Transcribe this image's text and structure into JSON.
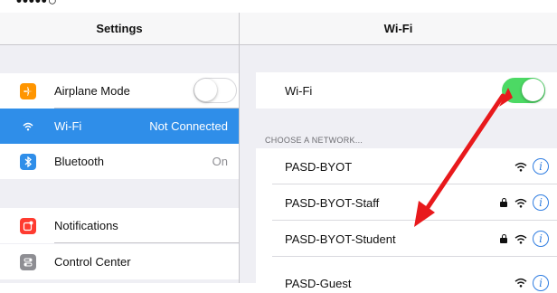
{
  "status_bar": {
    "text": "•••••○"
  },
  "settings": {
    "title": "Settings",
    "rows": [
      {
        "label": "Airplane Mode",
        "icon": "airplane-icon",
        "icon_color": "#ff9500",
        "toggle": "off"
      },
      {
        "label": "Wi-Fi",
        "value": "Not Connected",
        "icon": "wifi-icon",
        "icon_color": "#2f8ee9",
        "selected": true
      },
      {
        "label": "Bluetooth",
        "value": "On",
        "icon": "bluetooth-icon",
        "icon_color": "#2f8ee9"
      },
      {
        "label": "Notifications",
        "icon": "notifications-icon",
        "icon_color": "#ff3b30"
      },
      {
        "label": "Control Center",
        "icon": "control-center-icon",
        "icon_color": "#8e8e93"
      }
    ]
  },
  "wifi": {
    "title": "Wi-Fi",
    "toggle_label": "Wi-Fi",
    "toggle_state": "on",
    "section_label": "CHOOSE A NETWORK...",
    "networks": [
      {
        "name": "PASD-BYOT",
        "secured": false
      },
      {
        "name": "PASD-BYOT-Staff",
        "secured": true
      },
      {
        "name": "PASD-BYOT-Student",
        "secured": true
      },
      {
        "name": "PASD-Guest",
        "secured": false
      }
    ]
  },
  "annotation": {
    "arrow_color": "#e8191c"
  },
  "colors": {
    "accent": "#2f8ee9",
    "toggle_on": "#4cd964",
    "background": "#efeff4"
  }
}
